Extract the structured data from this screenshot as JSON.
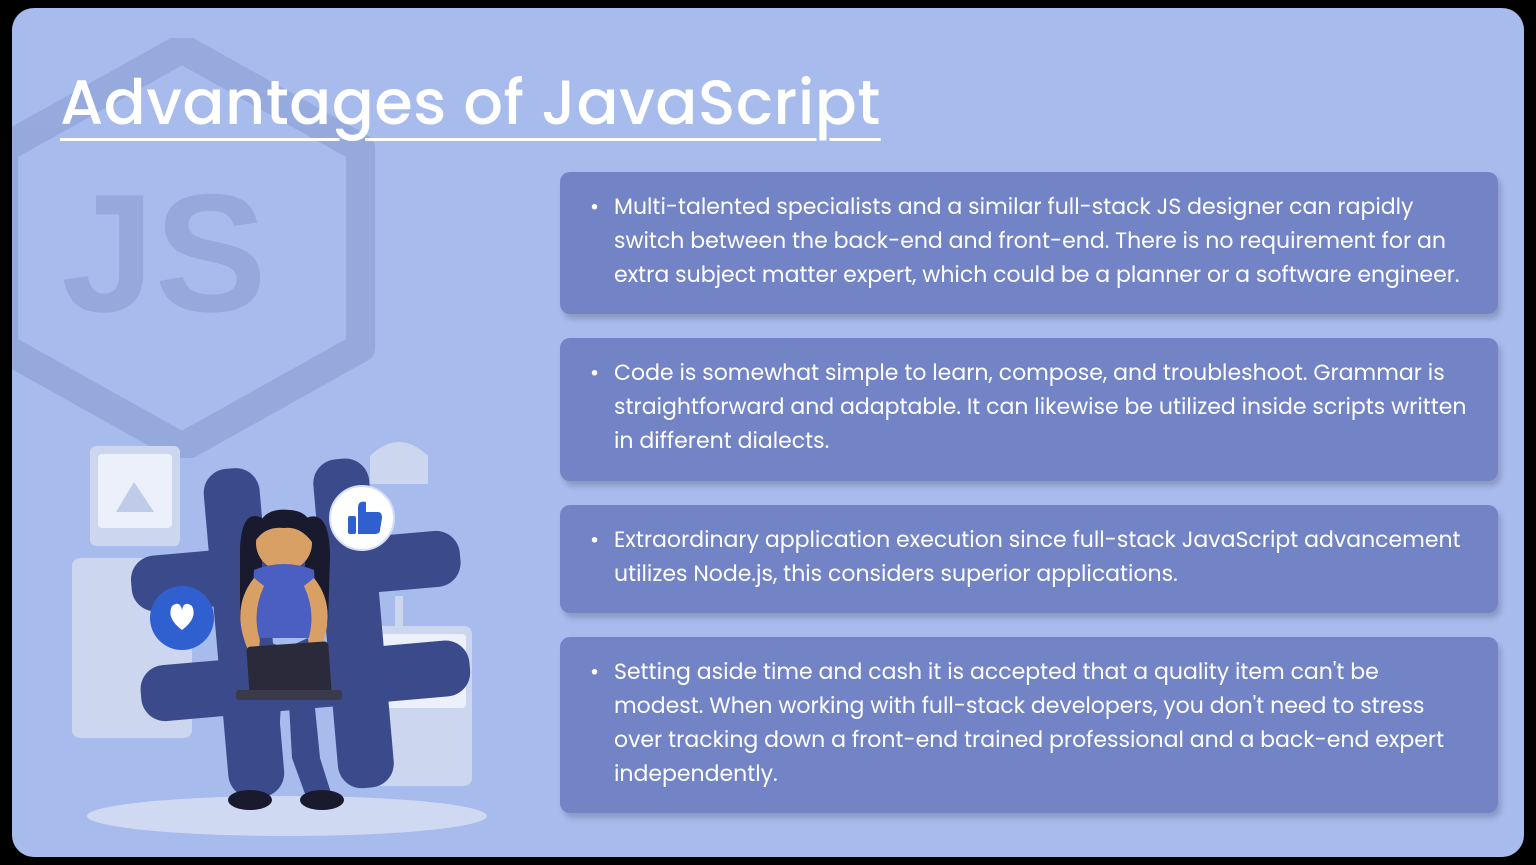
{
  "heading": "Advantages of JavaScript ",
  "cards": [
    "Multi-talented specialists and a similar full-stack JS designer can rapidly switch between the back-end and front-end. There is no requirement for an extra subject matter expert, which could be a planner or a software engineer.",
    "Code is somewhat simple to learn, compose, and troubleshoot. Grammar is straightforward and adaptable. It can likewise be utilized inside scripts written in different dialects.",
    "Extraordinary application execution since full-stack JavaScript advancement utilizes Node.js, this considers superior applications.",
    "Setting aside time and cash it is accepted that a quality item can't be modest. When working with full-stack developers, you don't need to stress over tracking down a front-end trained professional and a back-end expert independently."
  ]
}
